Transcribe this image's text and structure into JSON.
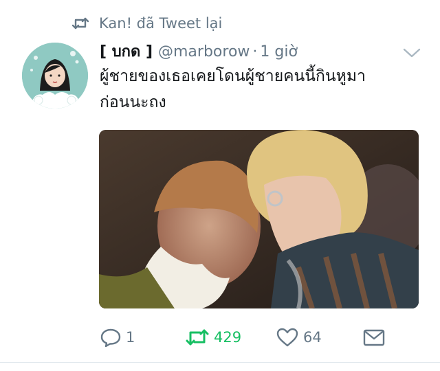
{
  "retweet_context": {
    "icon": "retweet-icon",
    "text": "Kan! đã Tweet lại"
  },
  "tweet": {
    "display_name": "[ บกด ]",
    "handle": "@marborow",
    "separator": "·",
    "timestamp": "1 giờ",
    "text": "ผู้ชายของเธอเคยโดนผู้ชายคนนี้กินหูมา\nก่อนนะถง",
    "more_icon": "chevron-down-icon",
    "avatar": "cartoon-girl-avatar",
    "media": "concert-photo"
  },
  "actions": {
    "reply": {
      "icon": "reply-icon",
      "count": "1"
    },
    "retweet": {
      "icon": "retweet-icon",
      "count": "429",
      "active": true,
      "color": "#17bf63"
    },
    "like": {
      "icon": "heart-icon",
      "count": "64"
    },
    "dm": {
      "icon": "envelope-icon"
    }
  },
  "colors": {
    "secondary_text": "#657786",
    "primary_text": "#14171a",
    "retweet_green": "#17bf63",
    "divider": "#e1e8ed"
  }
}
